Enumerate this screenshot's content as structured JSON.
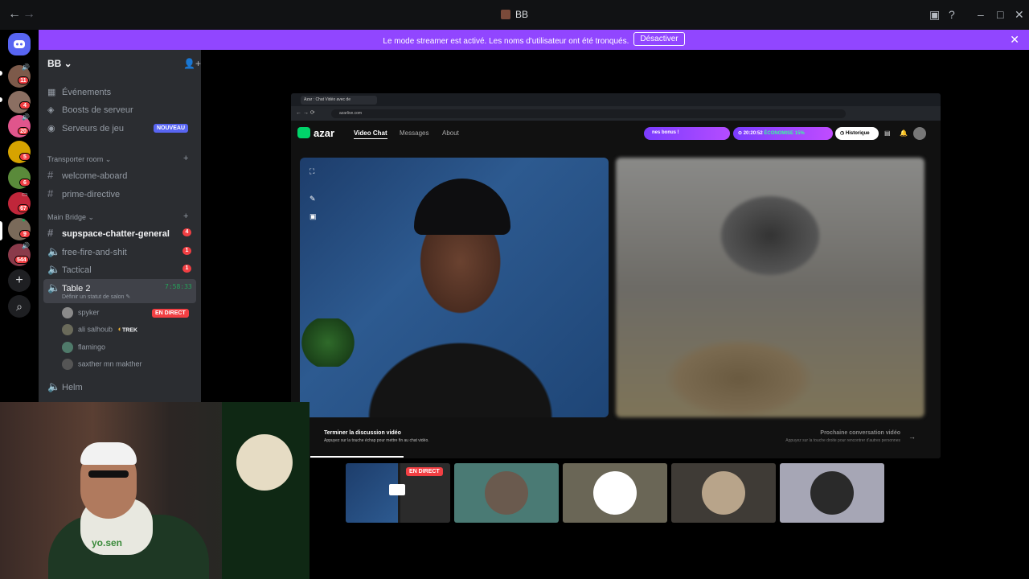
{
  "titlebar": {
    "title": "BB",
    "back": "←",
    "forward": "→",
    "icons": [
      "inbox-icon",
      "help-icon",
      "minimize-icon",
      "maximize-icon",
      "close-icon"
    ]
  },
  "banner": {
    "message": "Le mode streamer est activé. Les noms d'utilisateur ont été tronqués.",
    "button": "Désactiver",
    "close": "✕",
    "color": "#9146ff"
  },
  "rail": {
    "servers": [
      {
        "badge": "11",
        "color": "#7d5a4a"
      },
      {
        "badge": "4",
        "color": "#8b6f62"
      },
      {
        "badge": "20",
        "color": "#e0558c"
      },
      {
        "badge": "5",
        "color": "#d6a300"
      },
      {
        "badge": "6",
        "color": "#5a8a3a"
      },
      {
        "badge": "67",
        "color": "#c0263a"
      },
      {
        "badge": "9",
        "color": "#7a6a5a"
      },
      {
        "badge": "544",
        "color": "#8a3a4a"
      }
    ],
    "add": "+",
    "explore": "⌕"
  },
  "sidebar": {
    "server_name": "BB",
    "items": [
      {
        "label": "Événements",
        "icon": "calendar-icon"
      },
      {
        "label": "Boosts de serveur",
        "icon": "boost-icon"
      },
      {
        "label": "Serveurs de jeu",
        "icon": "gamepad-icon",
        "tag": "NOUVEAU"
      }
    ],
    "cat1": "Transporter room",
    "text_channels_1": [
      "welcome-aboard",
      "prime-directive"
    ],
    "cat2": "Main Bridge",
    "channels": [
      {
        "name": "supspace-chatter-general",
        "badge": "4",
        "unread": true,
        "type": "text"
      },
      {
        "name": "free-fire-and-shit",
        "badge": "1",
        "type": "voice"
      },
      {
        "name": "Tactical",
        "badge": "1",
        "type": "voice"
      }
    ],
    "active_channel": {
      "name": "Table 2",
      "timer": "7:58:33",
      "status": "Définir un statut de salon"
    },
    "voice_users": [
      {
        "name": "spyker",
        "live": "EN DIRECT"
      },
      {
        "name": "ali salhoub",
        "extra": "TREK"
      },
      {
        "name": "flamingo"
      },
      {
        "name": "saxther mn makther"
      }
    ],
    "last_channel": "Helm"
  },
  "browser": {
    "tab": "Azar : Chat Vidéo avec de",
    "url": "azarlive.com",
    "logo": "azar",
    "nav": [
      "Video Chat",
      "Messages",
      "About"
    ],
    "bonus": "nes bonus !",
    "timer": "⊙ 20:20:52",
    "economise": "ÉCONOMISE 15%",
    "historique": "Historique",
    "end_title": "Terminer la discussion vidéo",
    "end_sub": "Appuyez sur la touche échap pour mettre fin au chat vidéo.",
    "next_title": "Prochaine conversation vidéo",
    "next_sub": "Appuyez sur la touche droite pour rencontrer d'autres personnes"
  },
  "tiles": {
    "live": "EN DIRECT"
  },
  "webcam": {
    "print": "yo.sen"
  }
}
